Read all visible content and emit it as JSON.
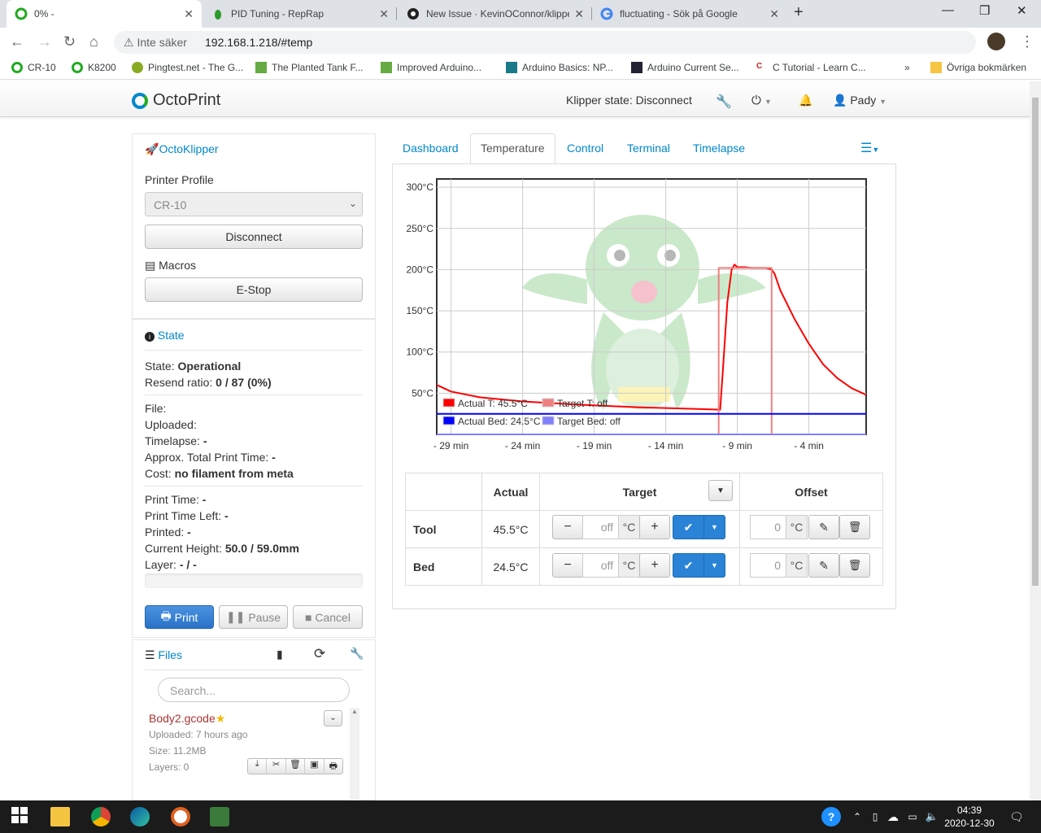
{
  "browser": {
    "tabs": [
      {
        "title": "0% -",
        "active": true,
        "favicon": "octoprint-icon"
      },
      {
        "title": "PID Tuning - RepRap",
        "active": false,
        "favicon": "reprap-icon"
      },
      {
        "title": "New Issue · KevinOConnor/klipper",
        "active": false,
        "favicon": "github-icon"
      },
      {
        "title": "fluctuating - Sök på Google",
        "active": false,
        "favicon": "google-icon"
      }
    ],
    "security": "Inte säker",
    "url": "192.168.1.218/#temp",
    "bookmarks": [
      "CR-10",
      "K8200",
      "Pingtest.net - The G...",
      "The Planted Tank F...",
      "Improved Arduino...",
      "Arduino Basics: NP...",
      "Arduino Current Se...",
      "C Tutorial - Learn C..."
    ],
    "bookmarks_more": "»",
    "other_bookmarks": "Övriga bokmärken"
  },
  "octoprint": {
    "brand": "OctoPrint",
    "klipper_state": "Klipper state: Disconnect",
    "user": "Pady"
  },
  "sidebar": {
    "octoklipper": {
      "title": "OctoKlipper",
      "printer_profile_label": "Printer Profile",
      "printer_profile_value": "CR-10",
      "disconnect": "Disconnect",
      "macros_label": "Macros",
      "estop": "E-Stop"
    },
    "state": {
      "title": "State",
      "state_label": "State:",
      "state_value": "Operational",
      "resend_label": "Resend ratio:",
      "resend_value": "0 / 87 (0%)",
      "file_label": "File:",
      "uploaded_label": "Uploaded:",
      "timelapse_label": "Timelapse:",
      "timelapse_value": "-",
      "approx_label": "Approx. Total Print Time:",
      "approx_value": "-",
      "cost_label": "Cost:",
      "cost_value": "no filament from meta",
      "print_time_label": "Print Time:",
      "print_time_value": "-",
      "print_time_left_label": "Print Time Left:",
      "print_time_left_value": "-",
      "printed_label": "Printed:",
      "printed_value": "-",
      "height_label": "Current Height:",
      "height_value": "50.0 / 59.0mm",
      "layer_label": "Layer:",
      "layer_value": "- / -",
      "progress": 0,
      "print": "Print",
      "pause": "Pause",
      "cancel": "Cancel"
    },
    "files": {
      "title": "Files",
      "search_placeholder": "Search...",
      "items": [
        {
          "name": "Body2.gcode",
          "uploaded": "Uploaded: 7 hours ago",
          "size": "Size: 11.2MB",
          "layers": "Layers: 0"
        }
      ]
    }
  },
  "main_tabs": [
    "Dashboard",
    "Temperature",
    "Control",
    "Terminal",
    "Timelapse"
  ],
  "active_tab": "Temperature",
  "chart_data": {
    "type": "line",
    "x_ticks": [
      "- 29 min",
      "- 24 min",
      "- 19 min",
      "- 14 min",
      "- 9 min",
      "- 4 min"
    ],
    "y_ticks": [
      "300°C",
      "250°C",
      "200°C",
      "150°C",
      "100°C",
      "50°C"
    ],
    "xlim": [
      -30,
      0
    ],
    "ylim": [
      0,
      310
    ],
    "legend": [
      "Actual T: 45.5°C",
      "Target T: off",
      "Actual Bed: 24.5°C",
      "Target Bed: off"
    ],
    "legend_placement": "bottom-left",
    "grid": true,
    "series": [
      {
        "name": "Actual T: 45.5°C",
        "color": "#ff0000",
        "x": [
          -30,
          -29,
          -27,
          -24,
          -20,
          -16,
          -12,
          -10.2,
          -10,
          -9.7,
          -9.4,
          -9.2,
          -9,
          -8.5,
          -8,
          -7.5,
          -7,
          -6.6,
          -6.4,
          -6,
          -5,
          -4,
          -3,
          -2,
          -1,
          0
        ],
        "y": [
          60,
          52,
          45,
          40,
          36,
          33,
          31,
          30,
          80,
          160,
          200,
          206,
          203,
          203,
          202,
          202,
          202,
          200,
          195,
          175,
          140,
          110,
          85,
          68,
          56,
          48
        ]
      },
      {
        "name": "Target T: off",
        "color": "#f08080",
        "x": [
          -30,
          -10.3,
          -10.3,
          -6.6,
          -6.6,
          0
        ],
        "y": [
          0,
          0,
          202,
          202,
          0,
          0
        ]
      },
      {
        "name": "Actual Bed: 24.5°C",
        "color": "#0000ff",
        "x": [
          -30,
          0
        ],
        "y": [
          25,
          25
        ]
      },
      {
        "name": "Target Bed: off",
        "color": "#8080ff",
        "x": [
          -30,
          0
        ],
        "y": [
          0,
          0
        ]
      }
    ]
  },
  "temp_table": {
    "headers": [
      "",
      "Actual",
      "Target",
      "Offset"
    ],
    "rows": [
      {
        "name": "Tool",
        "actual": "45.5°C",
        "target_placeholder": "off",
        "unit": "°C",
        "offset": "0"
      },
      {
        "name": "Bed",
        "actual": "24.5°C",
        "target_placeholder": "off",
        "unit": "°C",
        "offset": "0"
      }
    ]
  },
  "taskbar": {
    "time": "04:39",
    "date": "2020-12-30"
  }
}
